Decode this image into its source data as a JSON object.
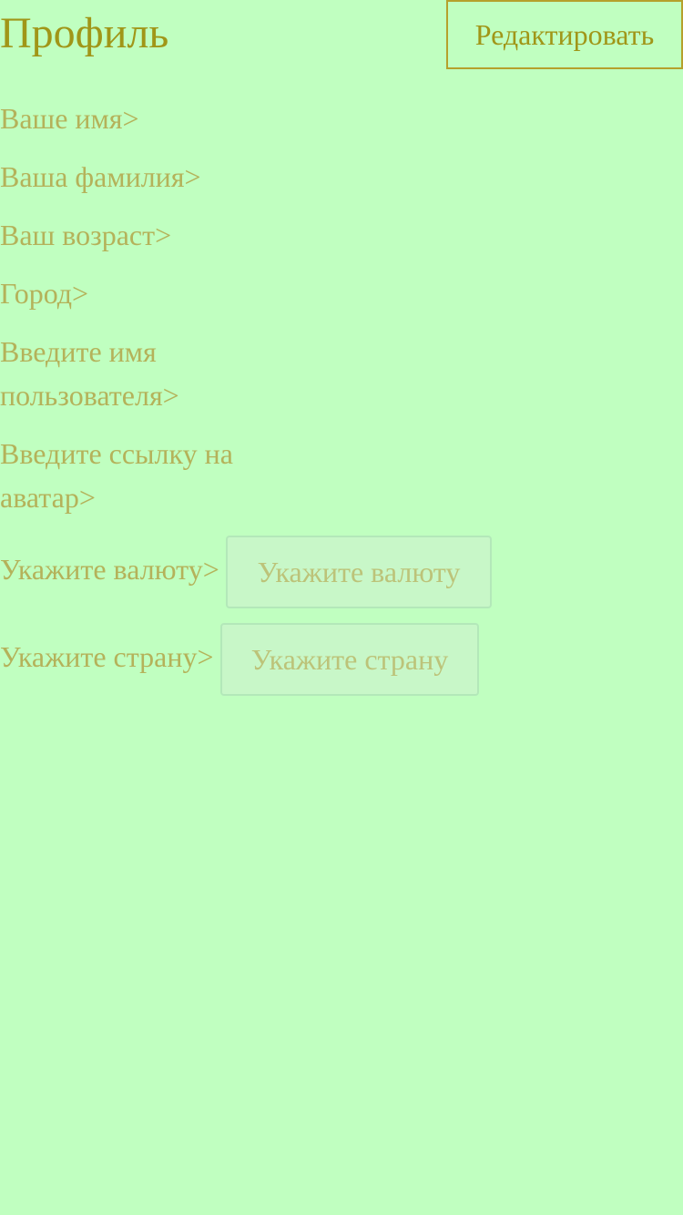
{
  "header": {
    "title": "Профиль",
    "edit_label": "Редактировать"
  },
  "fields": {
    "first_name": "Ваше имя>",
    "last_name": "Ваша фамилия>",
    "age": "Ваш возраст>",
    "city": "Город>",
    "username": "Введите имя пользователя>",
    "avatar_link": "Введите ссылку на аватар>",
    "currency": {
      "label": "Укажите валюту>",
      "button": "Укажите валюту"
    },
    "country": {
      "label": "Укажите страну>",
      "button": "Укажите страну"
    }
  },
  "colors": {
    "background": "#c0ffc0",
    "accent": "#a09618",
    "field_text": "#b4b25a",
    "muted_button": "#c8f7c8"
  }
}
